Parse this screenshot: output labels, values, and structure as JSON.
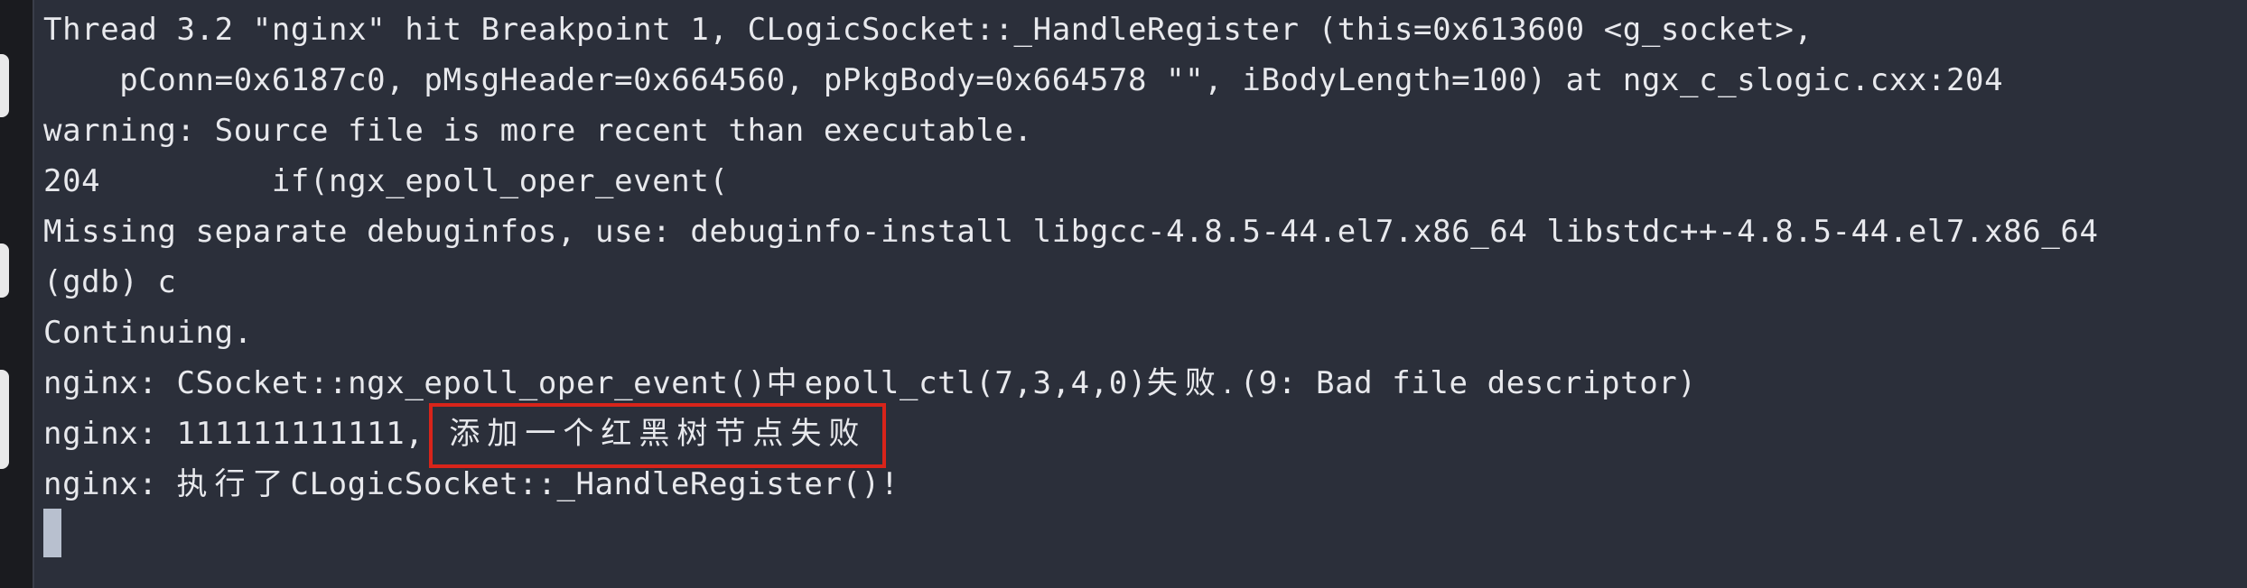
{
  "terminal": {
    "lines": [
      "Thread 3.2 \"nginx\" hit Breakpoint 1, CLogicSocket::_HandleRegister (this=0x613600 <g_socket>,",
      "    pConn=0x6187c0, pMsgHeader=0x664560, pPkgBody=0x664578 \"\", iBodyLength=100) at ngx_c_slogic.cxx:204",
      "warning: Source file is more recent than executable.",
      "204         if(ngx_epoll_oper_event(",
      "Missing separate debuginfos, use: debuginfo-install libgcc-4.8.5-44.el7.x86_64 libstdc++-4.8.5-44.el7.x86_64",
      "(gdb) c",
      "Continuing."
    ],
    "line_socket_prefix": "nginx: CSocket::ngx_epoll_oper_event()",
    "line_socket_cjk": "中",
    "line_socket_mid": "epoll_ctl(7,3,4,0)",
    "line_socket_cjk2": "失败.",
    "line_socket_suffix": "(9: Bad file descriptor)",
    "line_highlight_prefix": "nginx: 111111111111,",
    "line_highlight_boxed": "添加一个红黑树节点失败",
    "line_exec_prefix": "nginx: ",
    "line_exec_cjk": "执行了",
    "line_exec_suffix": "CLogicSocket::_HandleRegister()!"
  },
  "colors": {
    "terminal_bg": "#2b2f3a",
    "text": "#e8e9ed",
    "highlight_border": "#d8241a",
    "cursor": "#b8c0cf"
  }
}
